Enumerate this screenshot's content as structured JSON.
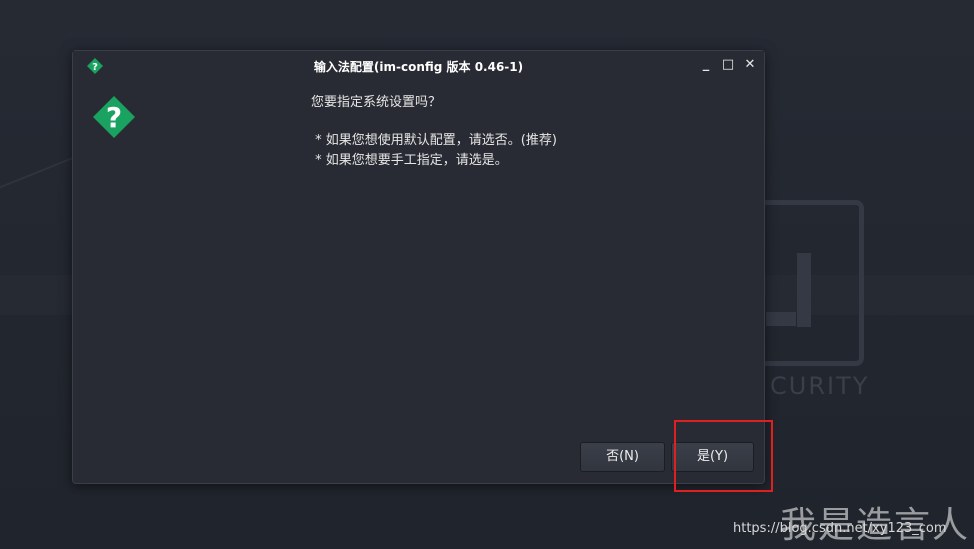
{
  "dialog": {
    "title": "输入法配置(im-config 版本 0.46-1)",
    "window_buttons": {
      "minimize": "_",
      "maximize": "□",
      "close": "✕"
    },
    "icon": "question-icon",
    "message": {
      "question": "您要指定系统设置吗？",
      "option_default": " * 如果您想使用默认配置，请选否。(推荐)",
      "option_manual": " * 如果您想要手工指定，请选是。"
    },
    "buttons": {
      "no_label": "否(N)",
      "yes_label": "是(Y)"
    }
  },
  "background": {
    "logo_text": "CURITY"
  },
  "watermark": {
    "url": "https://blog.csdn.net/xy123_com",
    "signature": "我是造言人"
  },
  "colors": {
    "accent_green": "#1aa260",
    "highlight_red": "#e02020",
    "dialog_bg": "#282b33"
  }
}
